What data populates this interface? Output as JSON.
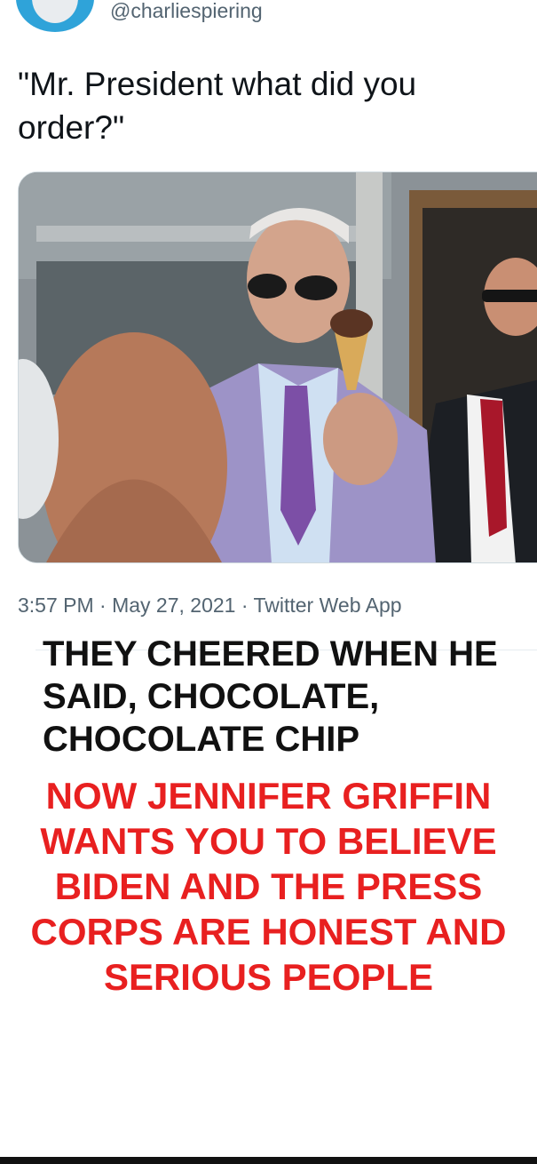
{
  "tweet": {
    "handle": "@charliespiering",
    "text": "\"Mr. President what did you order?\"",
    "timestamp": "3:57 PM · May 27, 2021 · Twitter Web App",
    "avatar_icon": "user-avatar-icon",
    "accent_color": "#1d9bf0"
  },
  "meme": {
    "black_caption": "THEY CHEERED WHEN HE SAID, CHOCOLATE, CHOCOLATE CHIP",
    "red_caption": "NOW JENNIFER GRIFFIN WANTS YOU TO BELIEVE BIDEN AND THE PRESS CORPS ARE HONEST AND SERIOUS PEOPLE",
    "red_color": "#e82020",
    "black_color": "#111111"
  }
}
